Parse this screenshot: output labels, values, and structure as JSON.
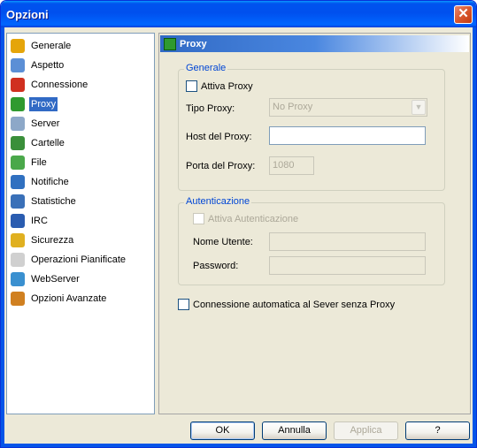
{
  "window": {
    "title": "Opzioni",
    "close_symbol": "✕"
  },
  "sidebar": {
    "items": [
      {
        "label": "Generale",
        "icon": "gear-icon",
        "color": "#e5a50a"
      },
      {
        "label": "Aspetto",
        "icon": "monitor-brush-icon",
        "color": "#5b8fd6"
      },
      {
        "label": "Connessione",
        "icon": "plug-icon",
        "color": "#d03020"
      },
      {
        "label": "Proxy",
        "icon": "proxy-icon",
        "color": "#2f9a2f",
        "selected": true
      },
      {
        "label": "Server",
        "icon": "server-icon",
        "color": "#8da8c8"
      },
      {
        "label": "Cartelle",
        "icon": "folder-icon",
        "color": "#3a8f3a"
      },
      {
        "label": "File",
        "icon": "file-icon",
        "color": "#4aa84a"
      },
      {
        "label": "Notifiche",
        "icon": "notification-icon",
        "color": "#3070c0"
      },
      {
        "label": "Statistiche",
        "icon": "statistics-icon",
        "color": "#3a70b8"
      },
      {
        "label": "IRC",
        "icon": "irc-icon",
        "color": "#2a5cb0"
      },
      {
        "label": "Sicurezza",
        "icon": "lock-icon",
        "color": "#e0b020"
      },
      {
        "label": "Operazioni Pianificate",
        "icon": "calendar-icon",
        "color": "#d0d0d0"
      },
      {
        "label": "WebServer",
        "icon": "globe-icon",
        "color": "#3a90d0"
      },
      {
        "label": "Opzioni Avanzate",
        "icon": "advanced-gear-icon",
        "color": "#d08020"
      }
    ]
  },
  "panel": {
    "title": "Proxy",
    "general": {
      "legend": "Generale",
      "enable_proxy": "Attiva Proxy",
      "proxy_type_label": "Tipo Proxy:",
      "proxy_type_value": "No Proxy",
      "host_label": "Host del Proxy:",
      "host_value": "",
      "port_label": "Porta del Proxy:",
      "port_value": "1080"
    },
    "auth": {
      "legend": "Autenticazione",
      "enable_auth": "Attiva Autenticazione",
      "user_label": "Nome Utente:",
      "user_value": "",
      "password_label": "Password:",
      "password_value": ""
    },
    "auto_connect": "Connessione automatica al Sever senza Proxy"
  },
  "buttons": {
    "ok": "OK",
    "cancel": "Annulla",
    "apply": "Applica",
    "help": "?"
  }
}
